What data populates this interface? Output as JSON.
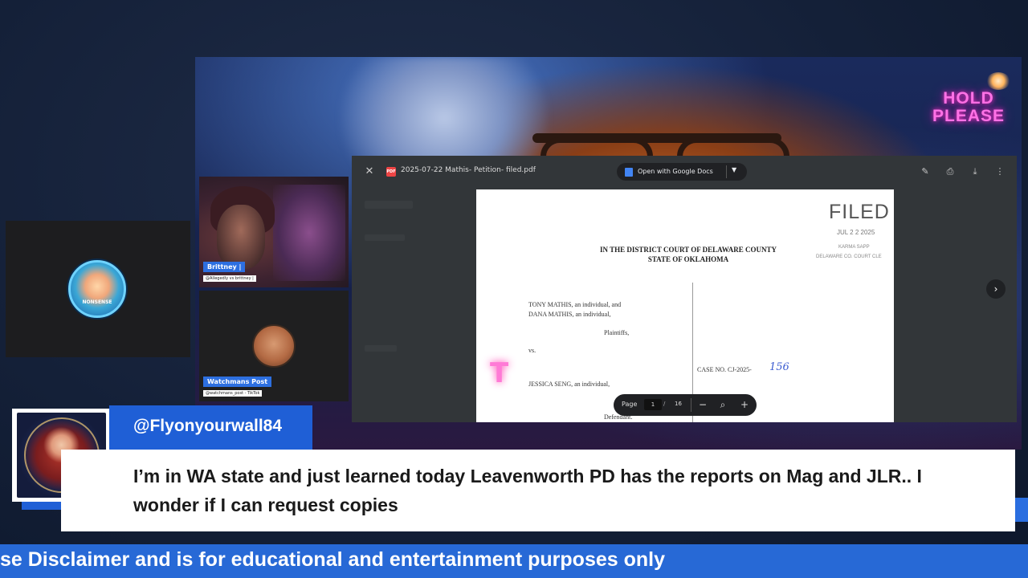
{
  "stream": {
    "hold_line1": "HOLD",
    "hold_line2": "PLEASE"
  },
  "side_tile": {
    "avatar_text": "NONSENSE"
  },
  "participants": [
    {
      "name": "Brittney |",
      "subtitle": "@Allegedly vs brittney |"
    },
    {
      "name": "Watchmans Post",
      "subtitle": "@watchmans_post - TikTok"
    }
  ],
  "pdf_viewer": {
    "close_icon": "✕",
    "file_name": "2025-07-22 Mathis- Petition- filed.pdf",
    "open_with": "Open with Google Docs",
    "actions": [
      "annotate-icon",
      "print-icon",
      "download-icon",
      "more-icon"
    ],
    "page_label": "Page",
    "current_page": "1",
    "page_sep": "/",
    "total_pages": "16"
  },
  "document": {
    "stamp_title": "FILED",
    "stamp_date": "JUL 2 2 2025",
    "stamp_clerk": "KARMA SAPP",
    "stamp_court": "DELAWARE CO. COURT CLE",
    "court_line1": "IN THE DISTRICT COURT OF DELAWARE COUNTY",
    "court_line2": "STATE OF OKLAHOMA",
    "plaintiff1": "TONY MATHIS, an individual, and",
    "plaintiff2": "DANA MATHIS, an individual,",
    "plaintiffs_label": "Plaintiffs,",
    "vs": "vs.",
    "defendant": "JESSICA SENG, an individual,",
    "defendant_label": "Defendant.",
    "case_no": "CASE NO. CJ-2025-",
    "case_no_hand": "156"
  },
  "comment": {
    "username": "@Flyonyourwall84",
    "message": "I’m in WA state and just learned today Leavenworth PD has the reports on Mag and JLR.. I wonder if I can request copies",
    "platform_icon": "youtube-icon"
  },
  "ticker": {
    "text": "se Disclaimer and is for educational and entertainment purposes only"
  },
  "colors": {
    "accent_blue": "#1f5fd6",
    "ticker_blue": "#2769d6",
    "neon_pink": "#ff72e6"
  }
}
